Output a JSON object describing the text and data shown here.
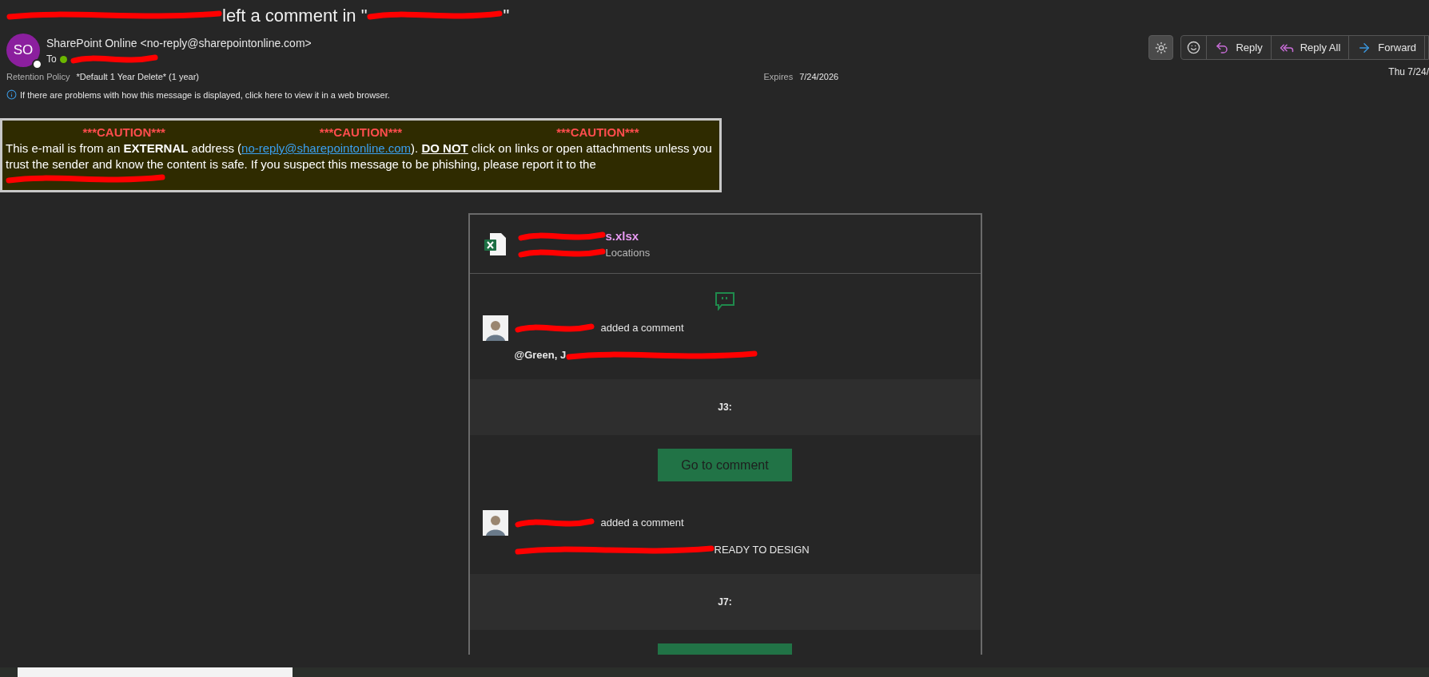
{
  "subject": {
    "before": "left a comment in \"",
    "after": "\""
  },
  "sender": {
    "initials": "SO",
    "name": "SharePoint Online <no-reply@sharepointonline.com>",
    "to_label": "To"
  },
  "retention": {
    "label": "Retention Policy",
    "value": "*Default 1 Year Delete* (1 year)",
    "expires_label": "Expires",
    "expires": "7/24/2026"
  },
  "info_bar": "If there are problems with how this message is displayed, click here to view it in a web browser.",
  "actions": [
    {
      "label": "Reply",
      "kind": "reply"
    },
    {
      "label": "Reply All",
      "kind": "reply_all"
    },
    {
      "label": "Forward",
      "kind": "forward"
    }
  ],
  "date": "Thu 7/24/",
  "caution": {
    "headings": [
      "***CAUTION***",
      "***CAUTION***",
      "***CAUTION***"
    ],
    "text_1": "This e-mail is from an **EXTERNAL** address (",
    "link": "no-reply@sharepointonline.com",
    "text_2": "). ",
    "warning": "DO NOT",
    "text_3": " click on links or open attachments unless you trust the sender and know the content is safe. If you suspect this message to be phishing, please report it to the"
  },
  "file": {
    "name": "s.xlsx",
    "subtitle": "Locations"
  },
  "comments": [
    {
      "action": "added a comment",
      "body": "@Green, J",
      "cell": "J3:",
      "button": "Go to comment"
    },
    {
      "action": "added a comment",
      "body_tail": "READY TO DESIGN",
      "cell": "J7:"
    }
  ]
}
